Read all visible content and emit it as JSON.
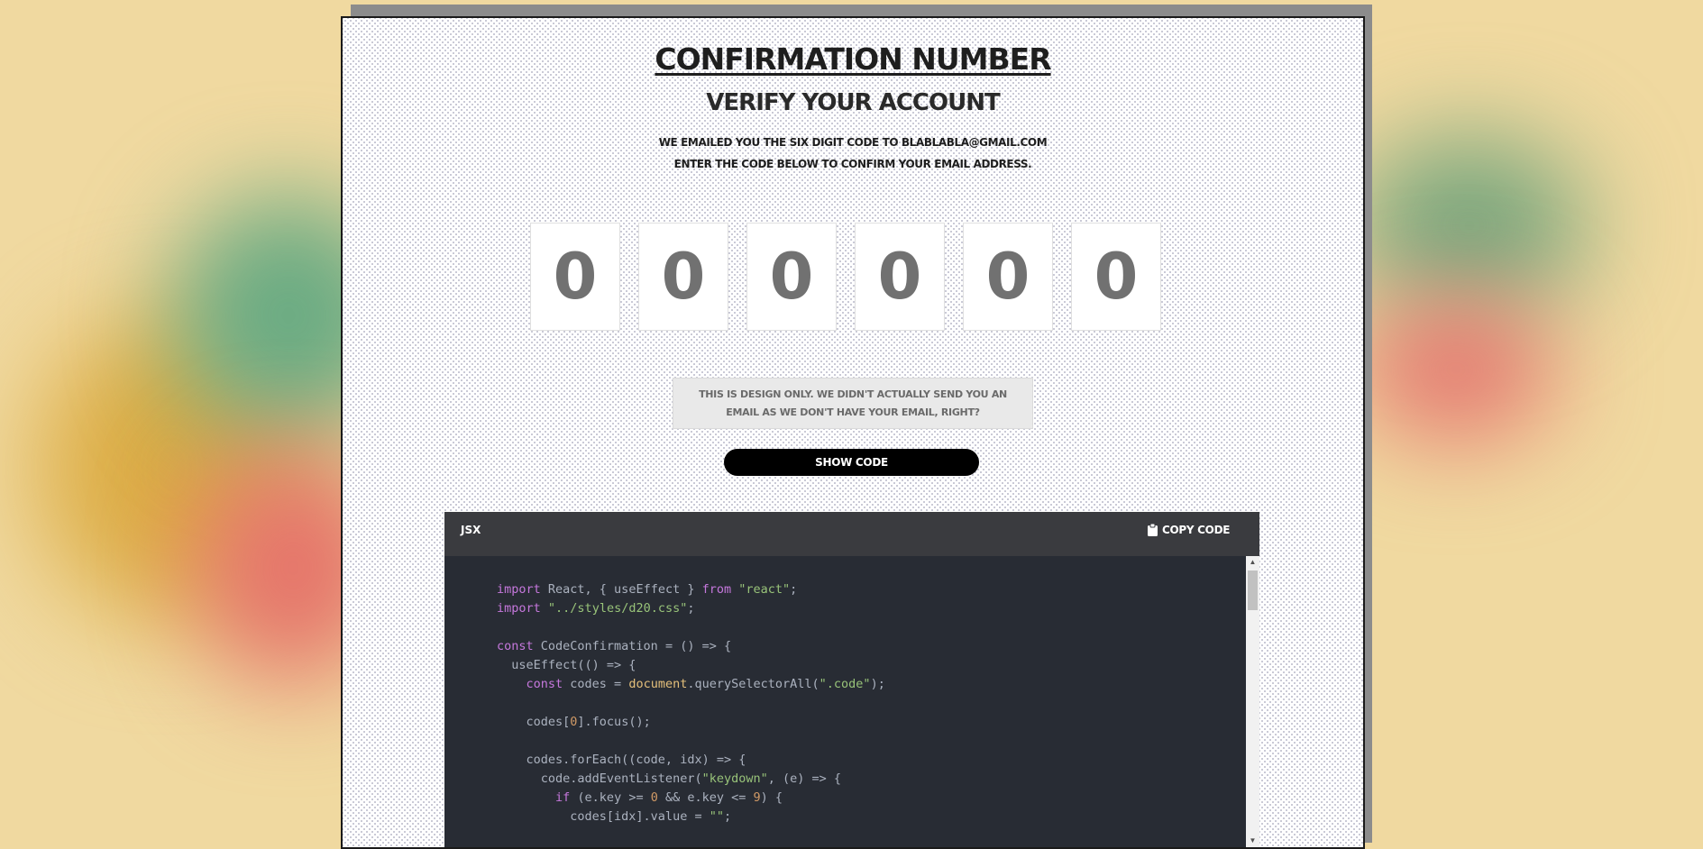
{
  "page": {
    "title": "Confirmation Number",
    "subtitle": "Verify your account",
    "description_line1": "We emailed you the six digit code to blablabla@gmail.com",
    "description_line2": "Enter the code below to confirm your email address."
  },
  "code_inputs": [
    "0",
    "0",
    "0",
    "0",
    "0",
    "0"
  ],
  "notice": "This is design only. We didn't actually send you an email as we don't have your email, right?",
  "show_code_button": "Show Code",
  "code_panel": {
    "language": "JSX",
    "copy_label": "Copy Code",
    "copy_icon": "clipboard-icon",
    "lines": [
      "import React, { useEffect } from \"react\";",
      "import \"../styles/d20.css\";",
      "",
      "const CodeConfirmation = () => {",
      "  useEffect(() => {",
      "    const codes = document.querySelectorAll(\".code\");",
      "",
      "    codes[0].focus();",
      "",
      "    codes.forEach((code, idx) => {",
      "      code.addEventListener(\"keydown\", (e) => {",
      "        if (e.key >= 0 && e.key <= 9) {",
      "          codes[idx].value = \"\";"
    ]
  },
  "colors": {
    "background": "#f0d9a0",
    "code_background": "#282c34",
    "keyword": "#c678dd",
    "string": "#98c379",
    "number": "#d19a66"
  }
}
